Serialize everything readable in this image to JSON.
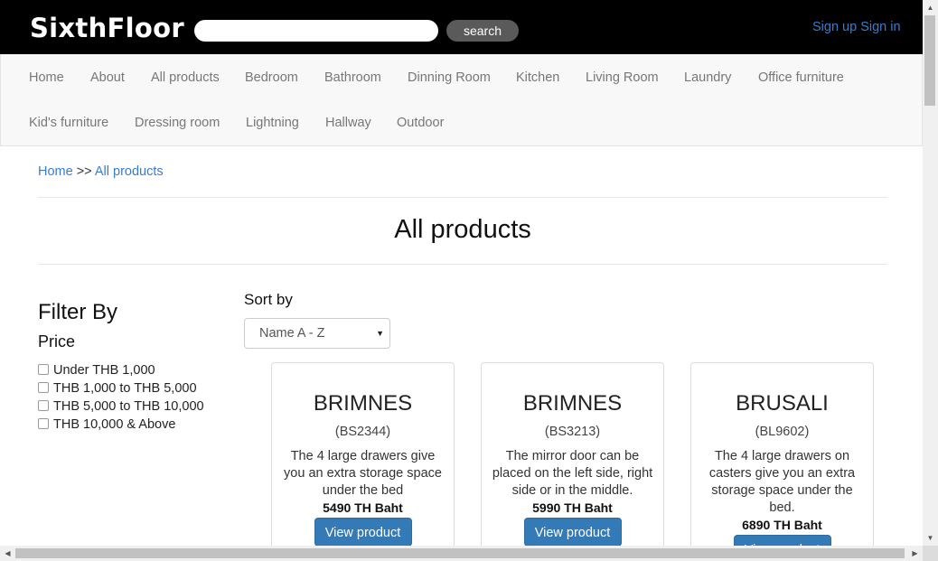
{
  "header": {
    "logo": "SixthFloor",
    "search_value": "",
    "search_button": "search",
    "sign_up": "Sign up",
    "sign_in": "Sign in"
  },
  "nav": {
    "items": [
      "Home",
      "About",
      "All products",
      "Bedroom",
      "Bathroom",
      "Dinning Room",
      "Kitchen",
      "Living Room",
      "Laundry",
      "Office furniture",
      "Kid's furniture",
      "Dressing room",
      "Lightning",
      "Hallway",
      "Outdoor"
    ]
  },
  "breadcrumb": {
    "home": "Home",
    "separator": ">>",
    "current": "All products"
  },
  "page_title": "All products",
  "filter": {
    "title": "Filter By",
    "price_title": "Price",
    "options": [
      "Under THB 1,000",
      "THB 1,000 to THB 5,000",
      "THB 5,000 to THB 10,000",
      "THB 10,000 & Above"
    ]
  },
  "sort": {
    "label": "Sort by",
    "selected": "Name A - Z",
    "arrow": "▼"
  },
  "products": [
    {
      "name": "BRIMNES",
      "code": "(BS2344)",
      "description": "The 4 large drawers give you an extra storage space under the bed",
      "price": "5490 TH Baht",
      "button": "View product"
    },
    {
      "name": "BRIMNES",
      "code": "(BS3213)",
      "description": "The mirror door can be placed on the left side, right side or in the middle.",
      "price": "5990 TH Baht",
      "button": "View product"
    },
    {
      "name": "BRUSALI",
      "code": "(BL9602)",
      "description": "The 4 large drawers on casters give you an extra storage space under the bed.",
      "price": "6890 TH Baht",
      "button": "View product"
    }
  ],
  "scrollbars": {
    "up": "▲",
    "down": "▼",
    "left": "◀",
    "right": "▶"
  }
}
